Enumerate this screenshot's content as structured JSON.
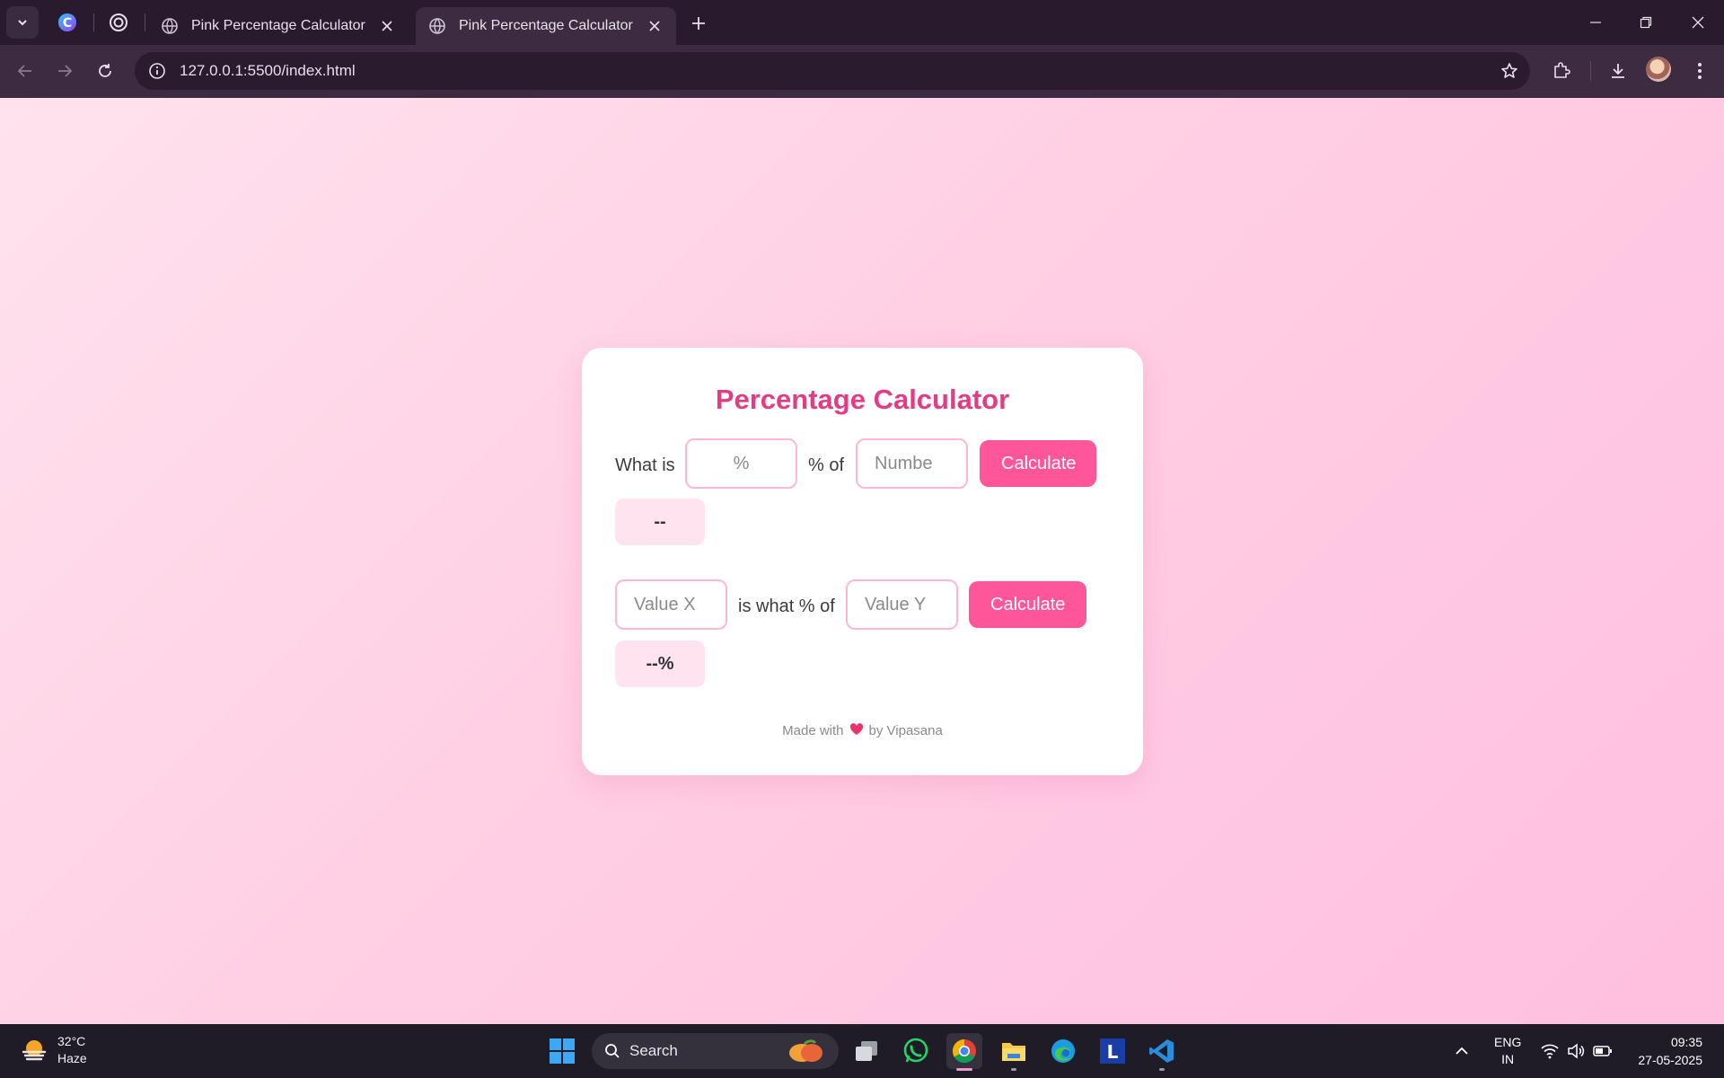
{
  "browser": {
    "tabs": [
      {
        "title": "Pink Percentage Calculator",
        "active": false
      },
      {
        "title": "Pink Percentage Calculator",
        "active": true
      }
    ],
    "url": "127.0.0.1:5500/index.html",
    "icons": {
      "tab_search": "chevron-down-icon",
      "pinned_1": "copilot-icon",
      "pinned_2": "chatgpt-icon",
      "back": "back-arrow-icon",
      "forward": "forward-arrow-icon",
      "reload": "reload-icon",
      "site_info": "info-icon",
      "bookmark": "star-icon",
      "extensions": "puzzle-icon",
      "downloads": "download-icon",
      "menu": "kebab-menu-icon"
    }
  },
  "app": {
    "title": "Percentage Calculator",
    "section1": {
      "label_before": "What is",
      "input1_placeholder": "%",
      "label_middle": "% of",
      "input2_placeholder": "Numbe",
      "button": "Calculate",
      "result": "--"
    },
    "section2": {
      "input1_placeholder": "Value X",
      "label_middle": "is what % of",
      "input2_placeholder": "Value Y",
      "button": "Calculate",
      "result": "--%"
    },
    "footer": {
      "before": "Made with",
      "after": "by Vipasana"
    },
    "colors": {
      "title": "#e03d86",
      "button": "#ff5599",
      "input_border": "#ffb6d3",
      "result_bg": "#ffe3ee",
      "page_bg_start": "#ffe2ee",
      "page_bg_end": "#ffbfdf"
    }
  },
  "taskbar": {
    "weather": {
      "temp": "32°C",
      "condition": "Haze"
    },
    "search_label": "Search",
    "language": {
      "line1": "ENG",
      "line2": "IN"
    },
    "time": "09:35",
    "date": "27-05-2025"
  }
}
